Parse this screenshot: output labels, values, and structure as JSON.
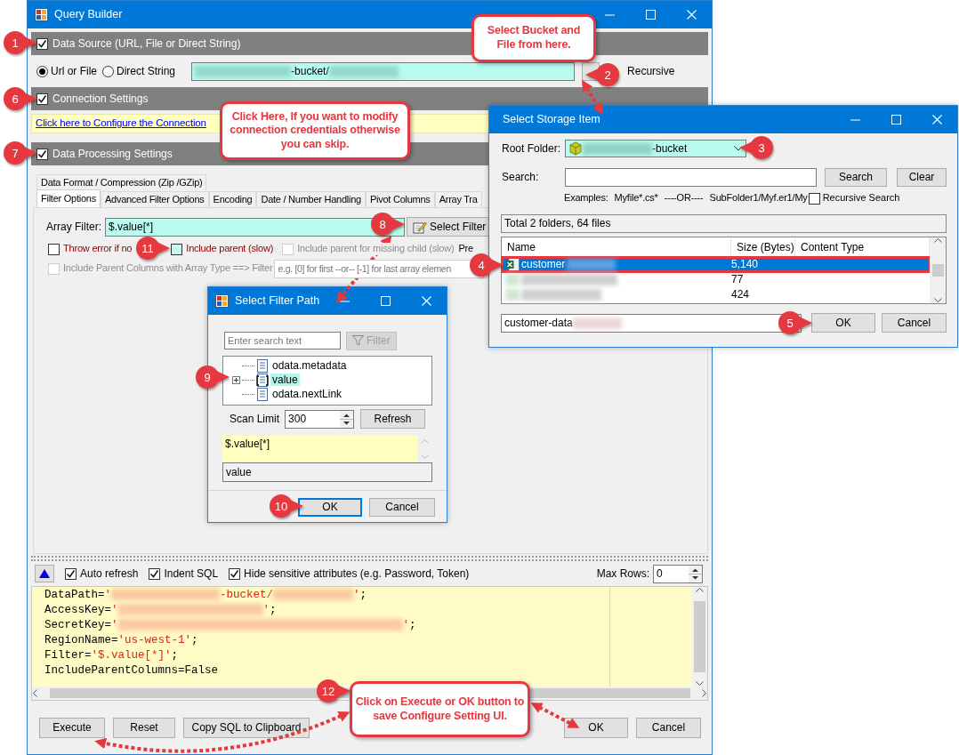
{
  "main_window": {
    "title": "Query Builder",
    "sections": [
      {
        "label": "Data Source (URL, File or Direct String)",
        "checked": true
      },
      {
        "label": "Connection Settings",
        "checked": true
      },
      {
        "label": "Data Processing Settings",
        "checked": true
      }
    ],
    "source_modes": [
      {
        "label": "Url or File",
        "selected": true
      },
      {
        "label": "Direct String",
        "selected": false
      }
    ],
    "data_path": [
      {
        "kind": "redacted"
      },
      {
        "kind": "plain",
        "text": "-bucket/"
      },
      {
        "kind": "redacted"
      }
    ],
    "recursive_label": "Recursive",
    "connection_link": "Click here to Configure the Connection",
    "tab_rows": [
      [
        {
          "label": "Data Format / Compression (Zip /GZip)",
          "selected": false
        }
      ],
      [
        {
          "label": "Filter Options",
          "selected": true
        },
        {
          "label": "Advanced Filter Options",
          "selected": false
        },
        {
          "label": "Encoding",
          "selected": false
        },
        {
          "label": "Date / Number Handling",
          "selected": false
        },
        {
          "label": "Pivot Columns",
          "selected": false
        },
        {
          "label": "Array Tra",
          "selected": false
        }
      ]
    ],
    "array_filter_label": "Array Filter:",
    "array_filter": "$.value[*]",
    "select_filter_button": "Select Filter",
    "options": [
      {
        "label": "Throw error if no",
        "checked": false,
        "disabled": false,
        "highlighted": false,
        "color": "#8b0000"
      },
      {
        "label": "Include parent (slow)",
        "checked": false,
        "disabled": false,
        "highlighted": true,
        "color": "#8b0000"
      },
      {
        "label": "Include parent for missing child (slow)",
        "checked": false,
        "disabled": true,
        "highlighted": false
      }
    ],
    "cut_label": "Pre",
    "parent_columns": {
      "label": "Include Parent Columns with Array Type ==> Filter",
      "checked": false,
      "disabled": true,
      "placeholder": "e.g. [0] for first --or-- [-1] for last array elemen"
    },
    "sql_options": [
      {
        "label": "Auto refresh",
        "checked": true
      },
      {
        "label": "Indent SQL",
        "checked": true
      },
      {
        "label": "Hide sensitive attributes (e.g. Password, Token)",
        "checked": true
      }
    ],
    "max_rows_label": "Max Rows:",
    "max_rows": "0",
    "sql_lines": [
      [
        {
          "kind": "plain",
          "text": "DataPath="
        },
        {
          "kind": "string",
          "text": "'"
        },
        {
          "kind": "redacted"
        },
        {
          "kind": "string",
          "text": "-bucket/"
        },
        {
          "kind": "redacted"
        },
        {
          "kind": "string",
          "text": "'"
        },
        {
          "kind": "plain",
          "text": ";"
        }
      ],
      [
        {
          "kind": "plain",
          "text": "AccessKey="
        },
        {
          "kind": "string",
          "text": "'"
        },
        {
          "kind": "redacted"
        },
        {
          "kind": "string",
          "text": "'"
        },
        {
          "kind": "plain",
          "text": ";"
        }
      ],
      [
        {
          "kind": "plain",
          "text": "SecretKey="
        },
        {
          "kind": "string",
          "text": "'"
        },
        {
          "kind": "redacted"
        },
        {
          "kind": "string",
          "text": "'"
        },
        {
          "kind": "plain",
          "text": ";"
        }
      ],
      [
        {
          "kind": "plain",
          "text": "RegionName="
        },
        {
          "kind": "string",
          "text": "'us-west-1'"
        },
        {
          "kind": "plain",
          "text": ";"
        }
      ],
      [
        {
          "kind": "plain",
          "text": "Filter="
        },
        {
          "kind": "string",
          "text": "'$.value[*]'"
        },
        {
          "kind": "plain",
          "text": ";"
        }
      ],
      [
        {
          "kind": "plain",
          "text": "IncludeParentColumns=False"
        }
      ]
    ],
    "buttons": [
      "Execute",
      "Reset",
      "Copy SQL to Clipboard",
      "OK",
      "Cancel"
    ]
  },
  "storage_dialog": {
    "title": "Select Storage Item",
    "root_folder_label": "Root Folder:",
    "root_folder": [
      {
        "kind": "redacted"
      },
      {
        "kind": "plain",
        "text": "-bucket"
      }
    ],
    "search_label": "Search:",
    "search_buttons": [
      "Search",
      "Clear"
    ],
    "examples": [
      "Examples:",
      "Myfile*.cs*",
      "----OR----",
      "SubFolder1/Myf.er1/My"
    ],
    "recursive_search": {
      "label": "Recursive Search",
      "checked": false
    },
    "total": "Total 2 folders, 64 files",
    "columns": [
      "Name",
      "Size (Bytes)",
      "Content Type"
    ],
    "rows": [
      {
        "kind": "spreadsheet",
        "name": [
          {
            "kind": "plain",
            "text": "customer"
          },
          {
            "kind": "redacted"
          }
        ],
        "size": "5,140",
        "selected": true
      },
      {
        "kind": "hidden",
        "name": [
          {
            "kind": "redacted"
          }
        ],
        "size": "77",
        "selected": false
      },
      {
        "kind": "hidden",
        "name": [
          {
            "kind": "redacted"
          }
        ],
        "size": "424",
        "selected": false
      }
    ],
    "file_name": [
      {
        "kind": "plain",
        "text": "customer-data"
      },
      {
        "kind": "redacted"
      }
    ],
    "buttons": [
      "OK",
      "Cancel"
    ]
  },
  "filter_dialog": {
    "title": "Select Filter Path",
    "search_placeholder": "Enter search text",
    "filter_button": {
      "label": "Filter",
      "disabled": true
    },
    "tree": [
      {
        "label": "odata.metadata",
        "kind": "object",
        "selected": false,
        "expandable": false
      },
      {
        "label": "value",
        "kind": "array",
        "selected": true,
        "expandable": true
      },
      {
        "label": "odata.nextLink",
        "kind": "object",
        "selected": false,
        "expandable": false
      }
    ],
    "scan_limit_label": "Scan Limit",
    "scan_limit": "300",
    "refresh_button": "Refresh",
    "path": "$.value[*]",
    "name": "value",
    "buttons": [
      {
        "label": "OK",
        "focused": true
      },
      {
        "label": "Cancel",
        "focused": false
      }
    ]
  },
  "annotations": {
    "markers": [
      "1",
      "2",
      "6",
      "3",
      "7",
      "8",
      "11",
      "4",
      "5",
      "9",
      "10",
      "12"
    ],
    "callouts": [
      "Select Bucket and File from here.",
      "Click Here, If you want to modify connection credentials otherwise you can skip.",
      "Click on Execute or OK button to save Configure Setting UI."
    ]
  }
}
